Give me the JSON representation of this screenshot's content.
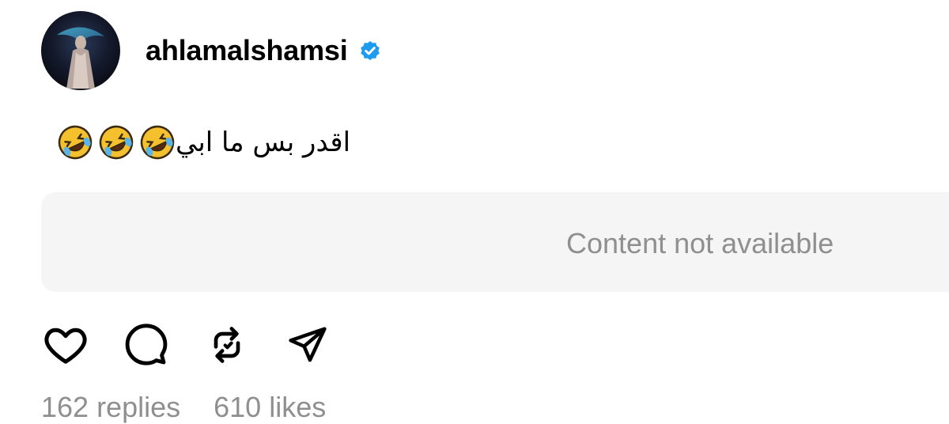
{
  "post": {
    "username": "ahlamalshamsi",
    "verified": true,
    "caption": "اقدر بس ما ابي",
    "caption_emojis": [
      "rolling-on-floor-laughing-emoji",
      "rolling-on-floor-laughing-emoji",
      "rolling-on-floor-laughing-emoji"
    ],
    "media_unavailable_text": "Content not available",
    "stats": {
      "replies": "162 replies",
      "likes": "610 likes"
    }
  },
  "actions": [
    {
      "icon": "heart-icon"
    },
    {
      "icon": "comment-icon"
    },
    {
      "icon": "repost-icon"
    },
    {
      "icon": "share-icon"
    }
  ],
  "colors": {
    "verified_badge": "#1d9bf0",
    "muted_text": "#8f8f8f",
    "media_box_bg": "#f5f5f5",
    "emoji_face": "#f5c02e"
  }
}
